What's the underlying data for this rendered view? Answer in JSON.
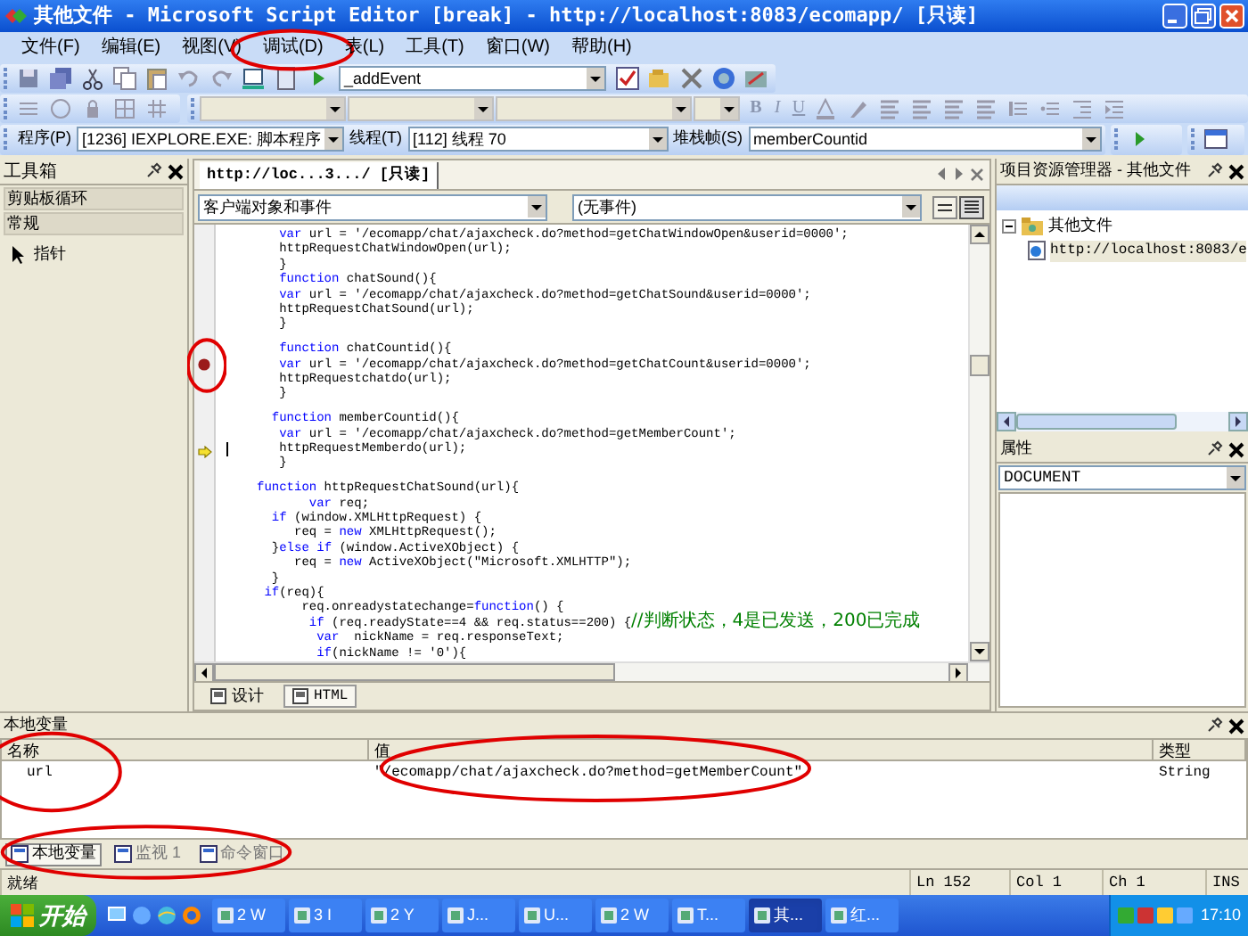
{
  "window": {
    "title": "其他文件 - Microsoft Script Editor [break] - http://localhost:8083/ecomapp/ [只读]"
  },
  "menu": [
    {
      "label": "文件(F)",
      "circled": false
    },
    {
      "label": "编辑(E)",
      "circled": false
    },
    {
      "label": "视图(V)",
      "circled": false
    },
    {
      "label": "调试(D)",
      "circled": true
    },
    {
      "label": "表(L)",
      "circled": false
    },
    {
      "label": "工具(T)",
      "circled": false
    },
    {
      "label": "窗口(W)",
      "circled": false
    },
    {
      "label": "帮助(H)",
      "circled": false
    }
  ],
  "toolbar": {
    "event_combo": "_addEvent",
    "format_buttons": [
      "B",
      "I",
      "U"
    ]
  },
  "debug_bar": {
    "program_label": "程序(P)",
    "program": "[1236] IEXPLORE.EXE: 脚本程序",
    "thread_label": "线程(T)",
    "thread": "[112] 线程 70",
    "frame_label": "堆栈帧(S)",
    "frame": "memberCountid"
  },
  "toolbox": {
    "title": "工具箱",
    "sections": [
      {
        "label": "剪贴板循环"
      },
      {
        "label": "常规"
      }
    ],
    "items": [
      {
        "label": "指针"
      }
    ]
  },
  "editor": {
    "tab": "http://loc...3.../ [只读]",
    "object_combo": "客户端对象和事件",
    "event_combo": "(无事件)",
    "lines": [
      {
        "segments": [
          {
            "kind": "keyword",
            "text": "        var"
          },
          {
            "kind": "plain",
            "text": " url = '/ecomapp/chat/ajaxcheck.do?method=getChatWindowOpen&userid=0000';"
          }
        ]
      },
      {
        "segments": [
          {
            "kind": "plain",
            "text": "        httpRequestChatWindowOpen(url);"
          }
        ]
      },
      {
        "segments": [
          {
            "kind": "plain",
            "text": "        }"
          }
        ]
      },
      {
        "segments": [
          {
            "kind": "keyword",
            "text": "        function"
          },
          {
            "kind": "plain",
            "text": " chatSound(){"
          }
        ]
      },
      {
        "segments": [
          {
            "kind": "keyword",
            "text": "        var"
          },
          {
            "kind": "plain",
            "text": " url = '/ecomapp/chat/ajaxcheck.do?method=getChatSound&userid=0000';"
          }
        ]
      },
      {
        "segments": [
          {
            "kind": "plain",
            "text": "        httpRequestChatSound(url);"
          }
        ]
      },
      {
        "segments": [
          {
            "kind": "plain",
            "text": "        }"
          }
        ]
      },
      {
        "blank_before": true,
        "segments": [
          {
            "kind": "keyword",
            "text": "        function"
          },
          {
            "kind": "plain",
            "text": " chatCountid(){"
          }
        ]
      },
      {
        "breakpoint": true,
        "circled": true,
        "segments": [
          {
            "kind": "keyword",
            "text": "        var"
          },
          {
            "kind": "plain",
            "text": " url = '/ecomapp/chat/ajaxcheck.do?method=getChatCount&userid=0000';"
          }
        ]
      },
      {
        "segments": [
          {
            "kind": "plain",
            "text": "        httpRequestchatdo(url);"
          }
        ]
      },
      {
        "segments": [
          {
            "kind": "plain",
            "text": "        }"
          }
        ]
      },
      {
        "blank_before": true,
        "segments": [
          {
            "kind": "keyword",
            "text": "       function"
          },
          {
            "kind": "plain",
            "text": " memberCountid(){"
          }
        ]
      },
      {
        "segments": [
          {
            "kind": "keyword",
            "text": "        var"
          },
          {
            "kind": "plain",
            "text": " url = '/ecomapp/chat/ajaxcheck.do?method=getMemberCount';"
          }
        ]
      },
      {
        "current": true,
        "cursor": true,
        "segments": [
          {
            "kind": "plain",
            "text": "        httpRequestMemberdo(url);"
          }
        ]
      },
      {
        "segments": [
          {
            "kind": "plain",
            "text": "        }"
          }
        ]
      },
      {
        "blank_before": true,
        "segments": [
          {
            "kind": "keyword",
            "text": "     function"
          },
          {
            "kind": "plain",
            "text": " httpRequestChatSound(url){"
          }
        ]
      },
      {
        "segments": [
          {
            "kind": "keyword",
            "text": "            var"
          },
          {
            "kind": "plain",
            "text": " req;"
          }
        ]
      },
      {
        "segments": [
          {
            "kind": "keyword",
            "text": "       if"
          },
          {
            "kind": "plain",
            "text": " (window.XMLHttpRequest) {"
          }
        ]
      },
      {
        "segments": [
          {
            "kind": "plain",
            "text": "          req = "
          },
          {
            "kind": "keyword",
            "text": "new"
          },
          {
            "kind": "plain",
            "text": " XMLHttpRequest();"
          }
        ]
      },
      {
        "segments": [
          {
            "kind": "plain",
            "text": "       }"
          },
          {
            "kind": "keyword",
            "text": "else if"
          },
          {
            "kind": "plain",
            "text": " (window.ActiveXObject) {"
          }
        ]
      },
      {
        "segments": [
          {
            "kind": "plain",
            "text": "          req = "
          },
          {
            "kind": "keyword",
            "text": "new"
          },
          {
            "kind": "plain",
            "text": " ActiveXObject(\"Microsoft.XMLHTTP\");"
          }
        ]
      },
      {
        "segments": [
          {
            "kind": "plain",
            "text": "       }"
          }
        ]
      },
      {
        "segments": [
          {
            "kind": "keyword",
            "text": "      if"
          },
          {
            "kind": "plain",
            "text": "(req){"
          }
        ]
      },
      {
        "segments": [
          {
            "kind": "plain",
            "text": "           req.onreadystatechange="
          },
          {
            "kind": "keyword",
            "text": "function"
          },
          {
            "kind": "plain",
            "text": "() {"
          }
        ]
      },
      {
        "segments": [
          {
            "kind": "keyword",
            "text": "            if"
          },
          {
            "kind": "plain",
            "text": " (req.readyState==4 && req.status==200) {"
          },
          {
            "kind": "comment",
            "text": "//判断状态，4是已发送，200已完成"
          }
        ]
      },
      {
        "segments": [
          {
            "kind": "keyword",
            "text": "             var"
          },
          {
            "kind": "plain",
            "text": "  nickName = req.responseText;"
          }
        ]
      },
      {
        "segments": [
          {
            "kind": "keyword",
            "text": "             if"
          },
          {
            "kind": "plain",
            "text": "(nickName != '0'){"
          }
        ]
      }
    ],
    "view_tabs": [
      {
        "label": "设计",
        "selected": false
      },
      {
        "label": "HTML",
        "selected": true
      }
    ]
  },
  "explorer": {
    "title": "项目资源管理器 - 其他文件",
    "tree": [
      {
        "label": "其他文件",
        "expanded": true,
        "children": [
          {
            "label": "http://localhost:8083/e"
          }
        ]
      }
    ]
  },
  "properties": {
    "title": "属性",
    "object": "DOCUMENT"
  },
  "locals": {
    "title": "本地变量",
    "columns": [
      {
        "label": "名称",
        "circled": true
      },
      {
        "label": "值",
        "circled": true
      },
      {
        "label": "类型",
        "circled": false
      }
    ],
    "rows": [
      {
        "cells": [
          "url",
          "\"/ecomapp/chat/ajaxcheck.do?method=getMemberCount\"",
          "String"
        ]
      }
    ]
  },
  "bottom_tabs": {
    "circled": true,
    "tabs": [
      {
        "label": "本地变量",
        "selected": true
      },
      {
        "label": "监视 1",
        "selected": false
      },
      {
        "label": "命令窗口",
        "selected": false
      }
    ]
  },
  "status_bar": [
    "就绪",
    "Ln 152",
    "Col 1",
    "Ch 1",
    "INS"
  ],
  "taskbar": {
    "start": "开始",
    "tasks": [
      {
        "label": "2 W",
        "selected": false
      },
      {
        "label": "3 I",
        "selected": false
      },
      {
        "label": "2 Y",
        "selected": false
      },
      {
        "label": "J...",
        "selected": false
      },
      {
        "label": "U...",
        "selected": false
      },
      {
        "label": "2 W",
        "selected": false
      },
      {
        "label": "T...",
        "selected": false
      },
      {
        "label": "其...",
        "selected": true
      },
      {
        "label": "红...",
        "selected": false
      }
    ],
    "clock": "17:10"
  }
}
